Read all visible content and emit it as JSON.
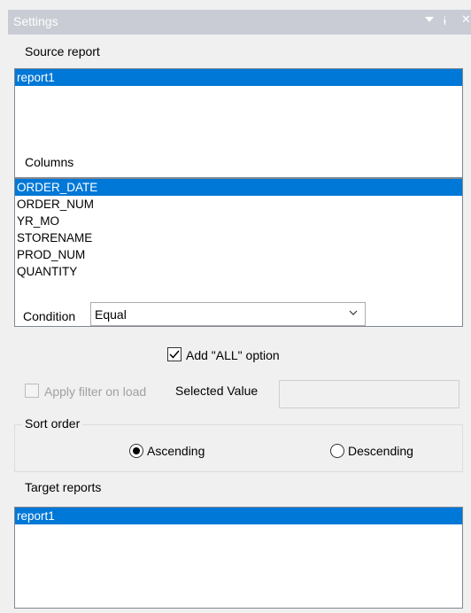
{
  "panel": {
    "title": "Settings",
    "controls": {
      "dropdown_icon": "dropdown-arrow",
      "pin_glyph": "ɨ",
      "close_glyph": "✕"
    }
  },
  "source_report": {
    "label": "Source report",
    "items": [
      {
        "label": "report1",
        "selected": true
      }
    ]
  },
  "columns": {
    "label": "Columns",
    "items": [
      {
        "label": "ORDER_DATE",
        "selected": true
      },
      {
        "label": "ORDER_NUM",
        "selected": false
      },
      {
        "label": "YR_MO",
        "selected": false
      },
      {
        "label": "STORENAME",
        "selected": false
      },
      {
        "label": "PROD_NUM",
        "selected": false
      },
      {
        "label": "QUANTITY",
        "selected": false
      }
    ]
  },
  "condition": {
    "label": "Condition",
    "value": "Equal"
  },
  "add_all_option": {
    "label": "Add \"ALL\" option",
    "checked": true
  },
  "apply_filter": {
    "label": "Apply filter on load",
    "checked": false,
    "enabled": false
  },
  "selected_value": {
    "label": "Selected Value",
    "value": ""
  },
  "sort_order": {
    "label": "Sort order",
    "ascending_label": "Ascending",
    "descending_label": "Descending",
    "selected": "ascending"
  },
  "target_reports": {
    "label": "Target reports",
    "items": [
      {
        "label": "report1",
        "selected": true
      }
    ]
  },
  "colors": {
    "selection": "#0078d7",
    "titlebar": "#c9ccd4",
    "panel_bg": "#f0f0f0"
  }
}
